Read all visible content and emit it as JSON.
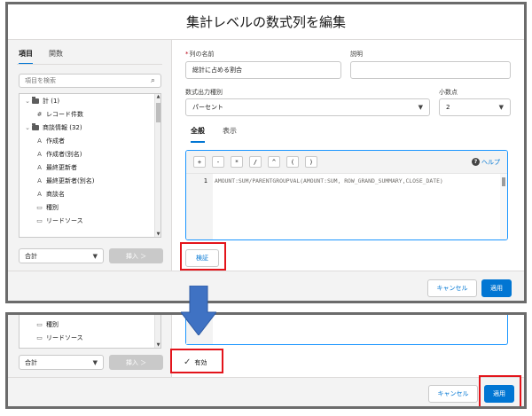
{
  "modal": {
    "title": "集計レベルの数式列を編集"
  },
  "left": {
    "tabs": [
      {
        "label": "項目"
      },
      {
        "label": "関数"
      }
    ],
    "search_placeholder": "項目を検索",
    "tree": [
      {
        "label": "計 (1)",
        "kind": "group"
      },
      {
        "label": "レコード件数",
        "glyph": "#"
      },
      {
        "label": "商談情報 (32)",
        "kind": "group"
      },
      {
        "label": "作成者",
        "glyph": "A"
      },
      {
        "label": "作成者(別名)",
        "glyph": "A"
      },
      {
        "label": "最終更新者",
        "glyph": "A"
      },
      {
        "label": "最終更新者(別名)",
        "glyph": "A"
      },
      {
        "label": "商談名",
        "glyph": "A"
      },
      {
        "label": "種別",
        "glyph": "▭"
      },
      {
        "label": "リードソース",
        "glyph": "▭"
      }
    ],
    "aggregate": "合計",
    "insert_label": "挿入 ＞"
  },
  "right": {
    "name_label": "列の名前",
    "name_required": "*",
    "name_value": "総計に占める割合",
    "desc_label": "説明",
    "desc_value": "",
    "output_label": "数式出力種別",
    "output_value": "パーセント",
    "decimal_label": "小数点",
    "decimal_value": "2",
    "subtabs": [
      {
        "label": "全般"
      },
      {
        "label": "表示"
      }
    ],
    "operators": [
      "+",
      "-",
      "*",
      "/",
      "^",
      "(",
      ")"
    ],
    "help_label": "ヘルプ",
    "line_number": "1",
    "formula": "AMOUNT:SUM/PARENTGROUPVAL(AMOUNT:SUM, ROW_GRAND_SUMMARY,CLOSE_DATE)",
    "validate_label": "検証"
  },
  "footer": {
    "cancel_label": "キャンセル",
    "apply_label": "適用"
  },
  "bottom": {
    "tree": [
      {
        "label": "種別",
        "glyph": "▭"
      },
      {
        "label": "リードソース",
        "glyph": "▭"
      }
    ],
    "aggregate": "合計",
    "insert_label": "挿入 ＞",
    "valid_label": "有効",
    "cancel_label": "キャンセル",
    "apply_label": "適用"
  },
  "colors": {
    "brand": "#0176d3",
    "highlight": "#e3141b",
    "arrow": "#3f72c3"
  }
}
